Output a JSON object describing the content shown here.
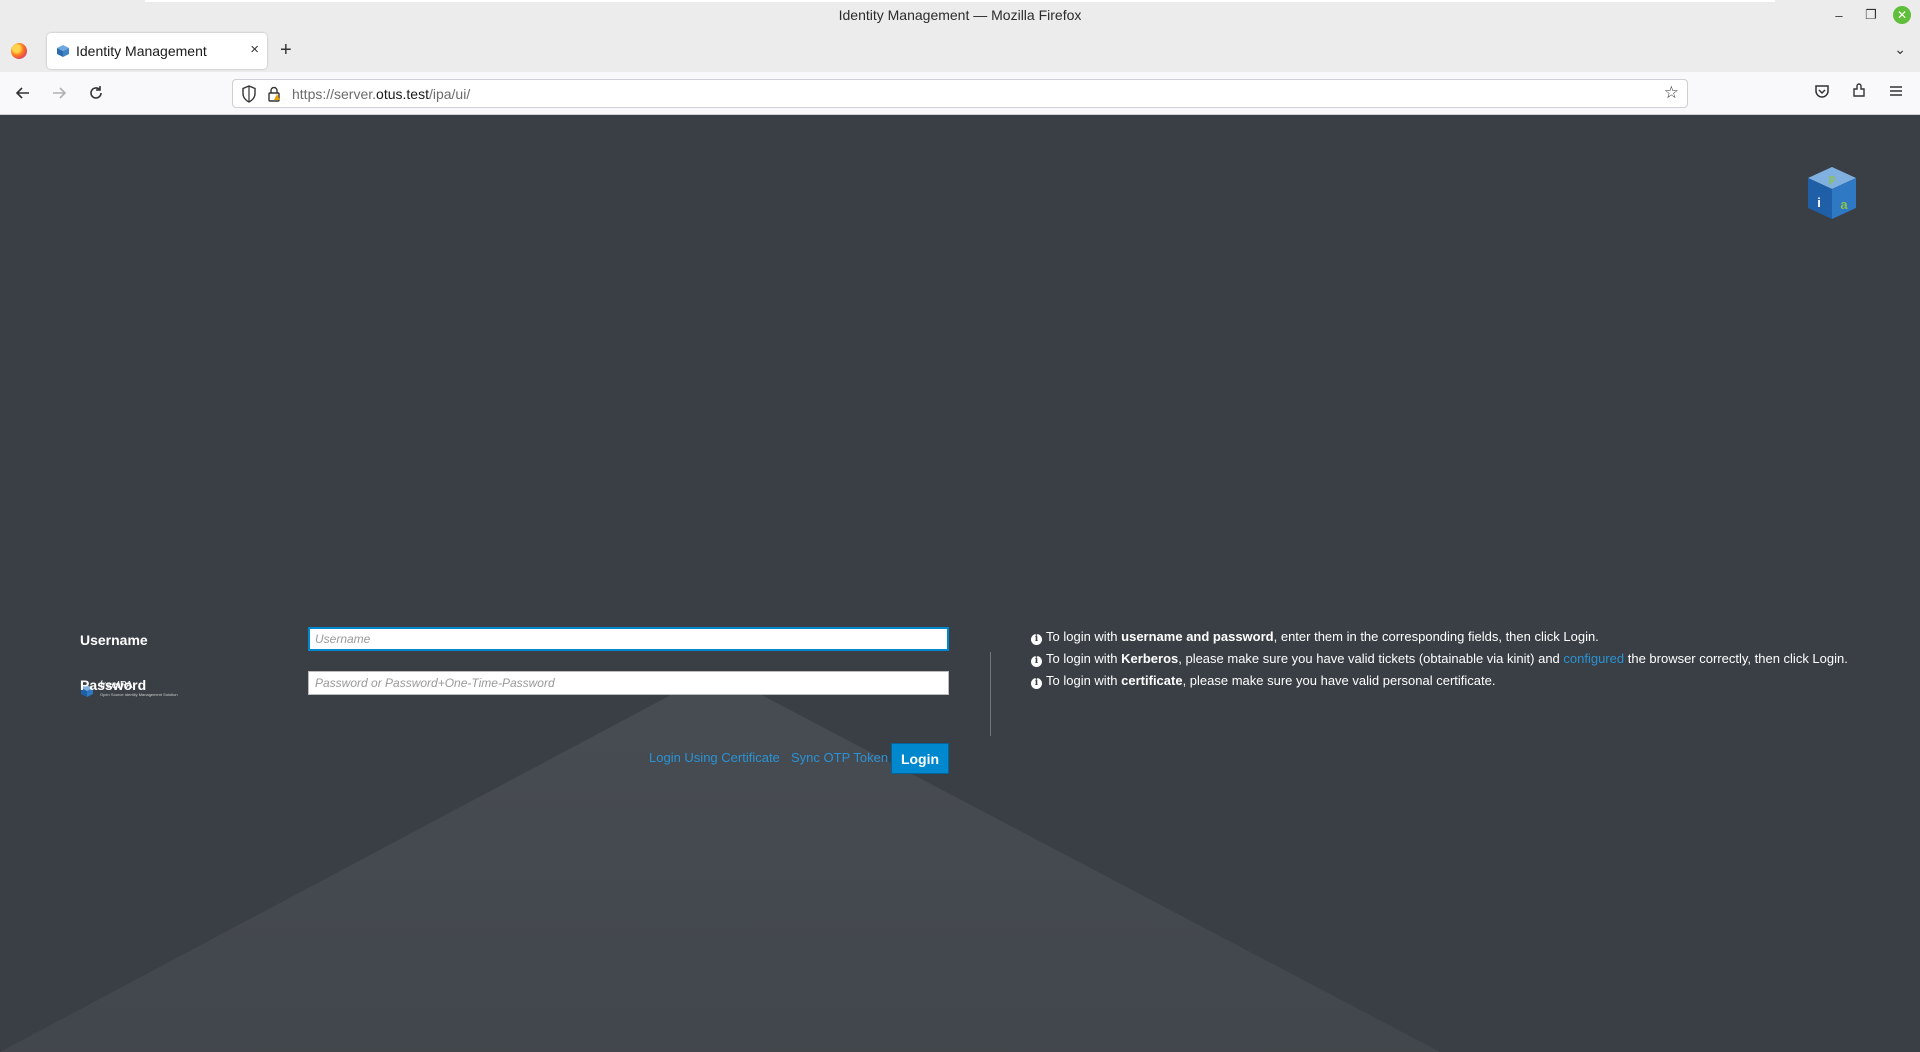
{
  "window": {
    "title": "Identity Management — Mozilla Firefox"
  },
  "tabs": [
    {
      "label": "Identity Management",
      "close": "×"
    }
  ],
  "tabbar": {
    "new_tab": "+",
    "list_tabs": "⌄"
  },
  "navbar": {
    "url_prefix": "https://server.",
    "url_host": "otus.test",
    "url_path": "/ipa/ui/"
  },
  "brand": {
    "name": "freeIPA",
    "tagline": "Open Source Identity Management Solution"
  },
  "login": {
    "username_label": "Username",
    "username_placeholder": "Username",
    "username_value": "",
    "password_label": "Password",
    "password_placeholder": "Password or Password+One-Time-Password",
    "password_value": "",
    "cert_link": "Login Using Certificate",
    "otp_link": "Sync OTP Token",
    "login_button": "Login"
  },
  "help": {
    "line1": {
      "pre": "To login with ",
      "bold": "username and password",
      "post": ", enter them in the corresponding fields, then click Login."
    },
    "line2": {
      "pre": "To login with ",
      "bold": "Kerberos",
      "mid": ", please make sure you have valid tickets (obtainable via kinit) and ",
      "link": "configured",
      "post": " the browser correctly, then click Login."
    },
    "line3": {
      "pre": "To login with ",
      "bold": "certificate",
      "post": ", please make sure you have valid personal certificate."
    }
  },
  "colors": {
    "page_bg": "#393f44",
    "accent": "#0088ce",
    "link": "#2b92d3"
  }
}
